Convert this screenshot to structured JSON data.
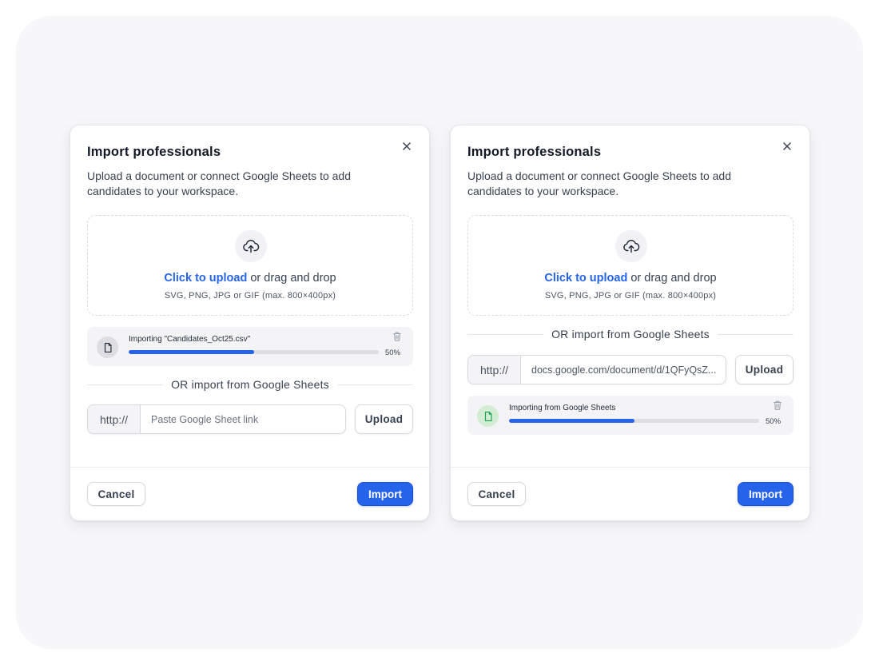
{
  "colors": {
    "accent": "#2563eb",
    "success_badge": "#d3ecd4",
    "file_icon_success": "#16a34a"
  },
  "modals": [
    {
      "title": "Import professionals",
      "subtitle": "Upload a document or connect Google Sheets to add candidates to your workspace.",
      "dropzone": {
        "link_text": "Click to upload",
        "rest_text": " or drag and drop",
        "hint": "SVG, PNG, JPG or GIF (max. 800×400px)",
        "icon": "cloud-upload-icon"
      },
      "progress": {
        "label": "Importing \"Candidates_Oct25.csv\"",
        "percent_text": "50%",
        "value": 0.5,
        "icon": "file-icon"
      },
      "divider_text": "OR import from Google Sheets",
      "url": {
        "prefix": "http://",
        "value": "",
        "placeholder": "Paste Google Sheet link"
      },
      "upload_label": "Upload",
      "cancel_label": "Cancel",
      "import_label": "Import"
    },
    {
      "title": "Import professionals",
      "subtitle": "Upload a document or connect Google Sheets to add candidates to your workspace.",
      "dropzone": {
        "link_text": "Click to upload",
        "rest_text": " or drag and drop",
        "hint": "SVG, PNG, JPG or GIF (max. 800×400px)",
        "icon": "cloud-upload-icon"
      },
      "divider_text": "OR import from Google Sheets",
      "url": {
        "prefix": "http://",
        "value": "docs.google.com/document/d/1QFyQsZ...",
        "placeholder": ""
      },
      "upload_label": "Upload",
      "progress": {
        "label": "Importing from Google Sheets",
        "percent_text": "50%",
        "value": 0.5,
        "icon": "file-icon"
      },
      "cancel_label": "Cancel",
      "import_label": "Import"
    }
  ]
}
